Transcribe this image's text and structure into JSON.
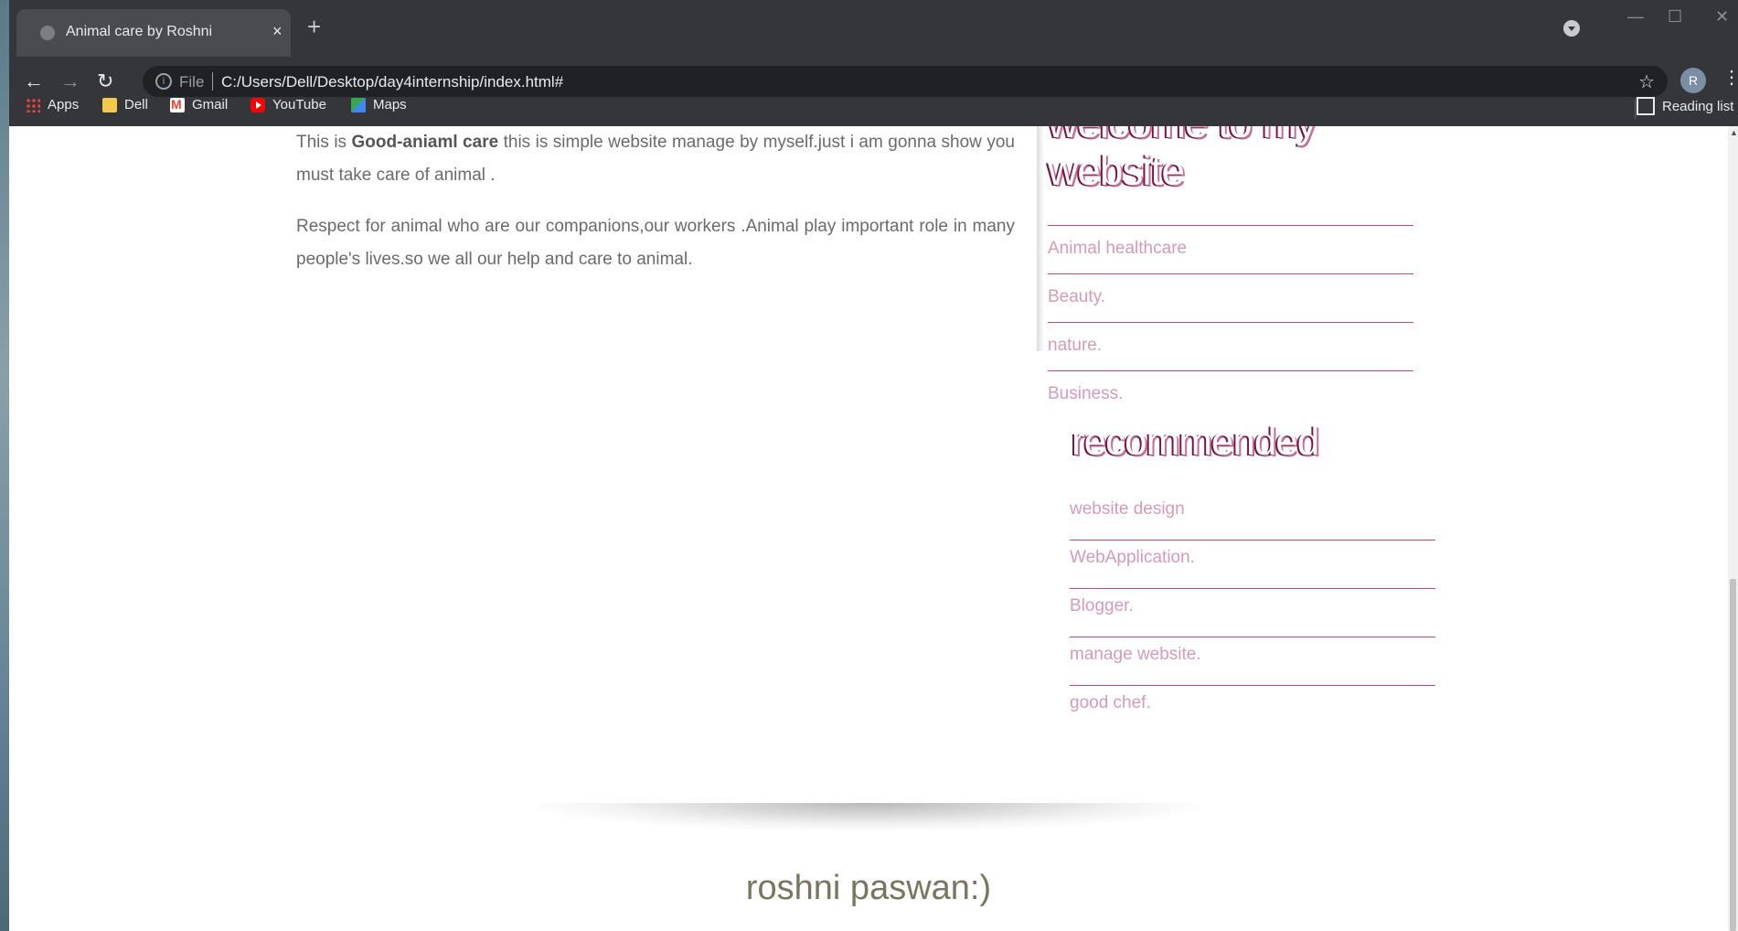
{
  "browser": {
    "tab_title": "Animal care by Roshni",
    "new_tab": "+",
    "tab_close": "×",
    "url_scheme": "File",
    "url": "C:/Users/Dell/Desktop/day4internship/index.html#",
    "profile_initial": "R",
    "bookmarks": [
      "Apps",
      "Dell",
      "Gmail",
      "YouTube",
      "Maps"
    ],
    "reading_list": "Reading list"
  },
  "content": {
    "p1_prefix": "This is ",
    "p1_bold": "Good-aniaml care",
    "p1_rest": " this is simple website manage by myself.just i am gonna show you must take care of animal .",
    "p2": "Respect for animal who are our companions,our workers .Animal play important role in many people's lives.so we all our help and care to animal."
  },
  "sidebar": {
    "welcome_heading": "welcome to my website",
    "links": [
      "Animal healthcare",
      "Beauty.",
      "nature.",
      "Business."
    ],
    "recommended_heading": "recommended",
    "recommended_links": [
      "website design",
      "WebApplication.",
      "Blogger.",
      "manage website.",
      "good chef."
    ]
  },
  "footer": {
    "name": "roshni paswan:)"
  },
  "colors": {
    "chrome_dark": "#35363a",
    "link_pink": "#d49cb4",
    "rule_magenta": "#c04a78",
    "heading_shadow": "#7a1040",
    "footer_text": "#7a7560"
  }
}
